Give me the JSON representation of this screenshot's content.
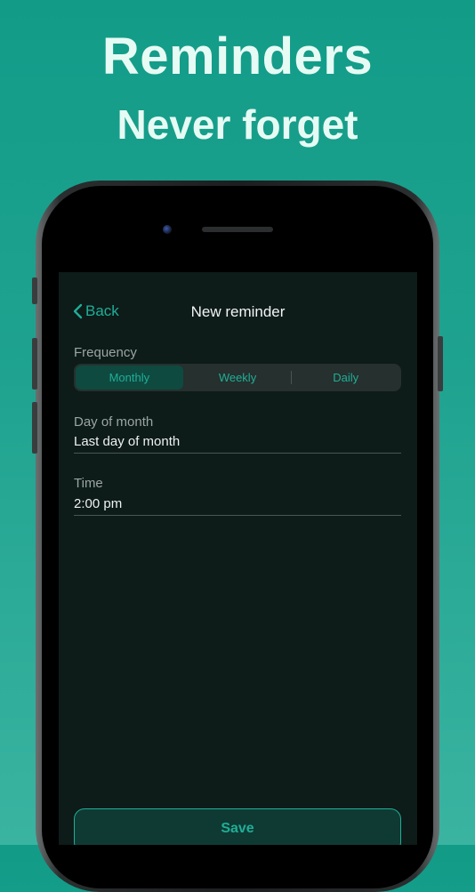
{
  "hero": {
    "title": "Reminders",
    "subtitle": "Never forget"
  },
  "nav": {
    "back_label": "Back",
    "title": "New reminder"
  },
  "frequency": {
    "label": "Frequency",
    "options": [
      "Monthly",
      "Weekly",
      "Daily"
    ],
    "selected": "Monthly"
  },
  "day_of_month": {
    "label": "Day of month",
    "value": "Last day of month"
  },
  "time": {
    "label": "Time",
    "value": "2:00 pm"
  },
  "save_label": "Save",
  "colors": {
    "background_top": "#129c88",
    "background_bottom": "#3ab4a1",
    "hero_text": "#e6fbf4",
    "accent": "#1fae96",
    "screen_bg": "#0d1b19",
    "segment_selected": "#0f4a41"
  }
}
